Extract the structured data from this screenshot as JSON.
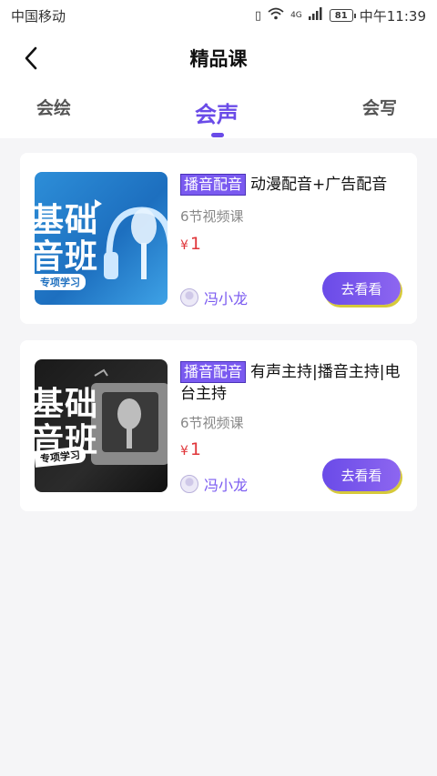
{
  "status_bar": {
    "carrier": "中国移动",
    "network": "4G",
    "battery": "81",
    "time": "中午11:39"
  },
  "header": {
    "title": "精品课"
  },
  "tabs": [
    {
      "label": "会绘"
    },
    {
      "label": "会声"
    },
    {
      "label": "会写"
    }
  ],
  "courses": [
    {
      "tag": "播音配音",
      "title": "动漫配音+广告配音",
      "lessons": "6节视频课",
      "currency": "¥",
      "price": "1",
      "teacher": "冯小龙",
      "button": "去看看",
      "thumb_text_1": "基础",
      "thumb_text_2": "音班",
      "thumb_sub": "专项学习"
    },
    {
      "tag": "播音配音",
      "title": "有声主持|播音主持|电台主持",
      "lessons": "6节视频课",
      "currency": "¥",
      "price": "1",
      "teacher": "冯小龙",
      "button": "去看看",
      "thumb_text_1": "基础",
      "thumb_text_2": "音班",
      "thumb_sub": "专项学习"
    }
  ],
  "colors": {
    "accent": "#6a4be8",
    "price": "#e0363a",
    "background": "#f5f5f7"
  }
}
